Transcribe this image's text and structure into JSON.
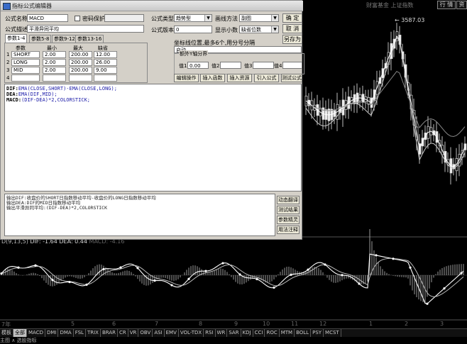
{
  "topbar": {
    "links_text": "财富基金 上证指数",
    "btn_quote": "行 情",
    "btn_info": "资 讯",
    "price_label": "3587.03"
  },
  "chart": {
    "macd_label": {
      "prefix": "D(9,13,5)",
      "dif": "DIF: -1.64",
      "dea": "DEA: 0.44",
      "macd": "MACD: -4.16"
    },
    "date_ticks": [
      "7年",
      "5",
      "6",
      "7",
      "8",
      "9",
      "10",
      "11",
      "12",
      "1",
      "2",
      "3"
    ]
  },
  "tabs": [
    "模板",
    "全部",
    "MACD",
    "DMI",
    "DMA",
    "FSL",
    "TRIX",
    "BRAR",
    "CR",
    "VR",
    "OBV",
    "ASI",
    "EMV",
    "VOL-TDX",
    "RSI",
    "WR",
    "SAR",
    "KDJ",
    "CCI",
    "ROC",
    "MTM",
    "BOLL",
    "PSY",
    "MCST"
  ],
  "active_tab": "全部",
  "status": "主图 ∧ 选股指标",
  "dialog": {
    "title": "指标公式编辑器",
    "name_label": "公式名称",
    "name_value": "MACD",
    "password_label": "密码保护",
    "desc_label": "公式描述",
    "desc_value": "平滑异同平均",
    "type_label": "公式类型",
    "type_value": "趋势型",
    "draw_label": "画线方法",
    "draw_value": "副图",
    "version_label": "公式版本",
    "version_value": "0",
    "decimals_label": "显示小数",
    "decimals_value": "缺省位数",
    "btn_ok": "确 定",
    "btn_cancel": "取 消",
    "btn_saveas": "另存为",
    "param_tabs": [
      "参数1-4",
      "参数5-8",
      "参数9-12",
      "参数13-16"
    ],
    "param_headers": [
      "参数",
      "最小",
      "最大",
      "缺省"
    ],
    "params": [
      {
        "row": "1",
        "name": "SHORT",
        "min": "2.00",
        "max": "200.00",
        "default": "12.00"
      },
      {
        "row": "2",
        "name": "LONG",
        "min": "2.00",
        "max": "200.00",
        "default": "26.00"
      },
      {
        "row": "3",
        "name": "MID",
        "min": "2.00",
        "max": "200.00",
        "default": "9.00"
      },
      {
        "row": "4",
        "name": "",
        "min": "",
        "max": "",
        "default": ""
      }
    ],
    "coord_label": "坐标线位置,最多6个,用分号分隔",
    "coord_value": "自动",
    "axis_legend": "额外Y轴分界",
    "axis_labels": [
      "值1",
      "值2",
      "值3",
      "值4"
    ],
    "axis_values": [
      "0.00",
      "",
      "",
      ""
    ],
    "action_buttons": [
      "编辑操作",
      "插入函数",
      "插入资源",
      "引入公式",
      "测试公式"
    ],
    "code_lines": [
      "DIF:EMA(CLOSE,SHORT)-EMA(CLOSE,LONG);",
      "DEA:EMA(DIF,MID);",
      "MACD:(DIF-DEA)*2,COLORSTICK;"
    ],
    "help_lines": [
      "输出DIF:收盘价的SHORT日指数移动平均-收盘价的LONG日指数移动平均",
      "输出DEA:DIF的MID日指数移动平均",
      "输出平滑异同平均:(DIF-DEA)*2,COLORSTICK"
    ],
    "side_buttons": [
      "动态翻译",
      "测试结果",
      "参数精灵",
      "用法注释"
    ]
  }
}
